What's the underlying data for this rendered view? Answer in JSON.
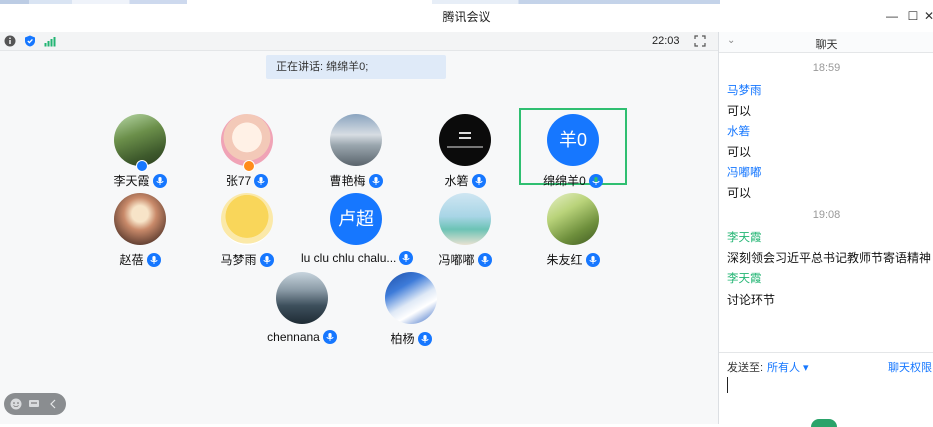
{
  "window": {
    "title": "腾讯会议"
  },
  "toolbar": {
    "clock": "22:03"
  },
  "stage": {
    "speaking": "正在讲话: 绵绵羊0;",
    "participants": [
      {
        "name": "李天霞",
        "avatar_text": ""
      },
      {
        "name": "张77",
        "avatar_text": ""
      },
      {
        "name": "曹艳梅",
        "avatar_text": ""
      },
      {
        "name": "水箬",
        "avatar_text": ""
      },
      {
        "name": "绵绵羊0",
        "avatar_text": "羊0"
      },
      {
        "name": "赵蓓",
        "avatar_text": ""
      },
      {
        "name": "马梦雨",
        "avatar_text": ""
      },
      {
        "name": "lu clu chlu chalu...",
        "avatar_text": "卢超"
      },
      {
        "name": "冯嘟嘟",
        "avatar_text": ""
      },
      {
        "name": "朱友红",
        "avatar_text": ""
      },
      {
        "name": "chennana",
        "avatar_text": ""
      },
      {
        "name": "柏杨",
        "avatar_text": ""
      }
    ]
  },
  "chat": {
    "title": "聊天",
    "messages": [
      {
        "type": "time",
        "text": "18:59"
      },
      {
        "type": "sender",
        "text": "马梦雨",
        "color": "#1677ff"
      },
      {
        "type": "text",
        "text": "可以"
      },
      {
        "type": "sender",
        "text": "水箬",
        "color": "#1677ff"
      },
      {
        "type": "text",
        "text": "可以"
      },
      {
        "type": "sender",
        "text": "冯嘟嘟",
        "color": "#1677ff"
      },
      {
        "type": "text",
        "text": "可以"
      },
      {
        "type": "time",
        "text": "19:08"
      },
      {
        "type": "sender",
        "text": "李天霞",
        "color": "#22b573"
      },
      {
        "type": "text",
        "text": "深刻领会习近平总书记教师节寄语精神"
      },
      {
        "type": "sender",
        "text": "李天霞",
        "color": "#22b573"
      },
      {
        "type": "text",
        "text": "讨论环节"
      }
    ],
    "send_to_label": "发送至:",
    "send_to_value": "所有人 ▾",
    "permission_label": "聊天权限 ▾"
  },
  "colors": {
    "accent": "#1677ff",
    "selected_border": "#2fbf71",
    "host_green": "#22b573"
  }
}
